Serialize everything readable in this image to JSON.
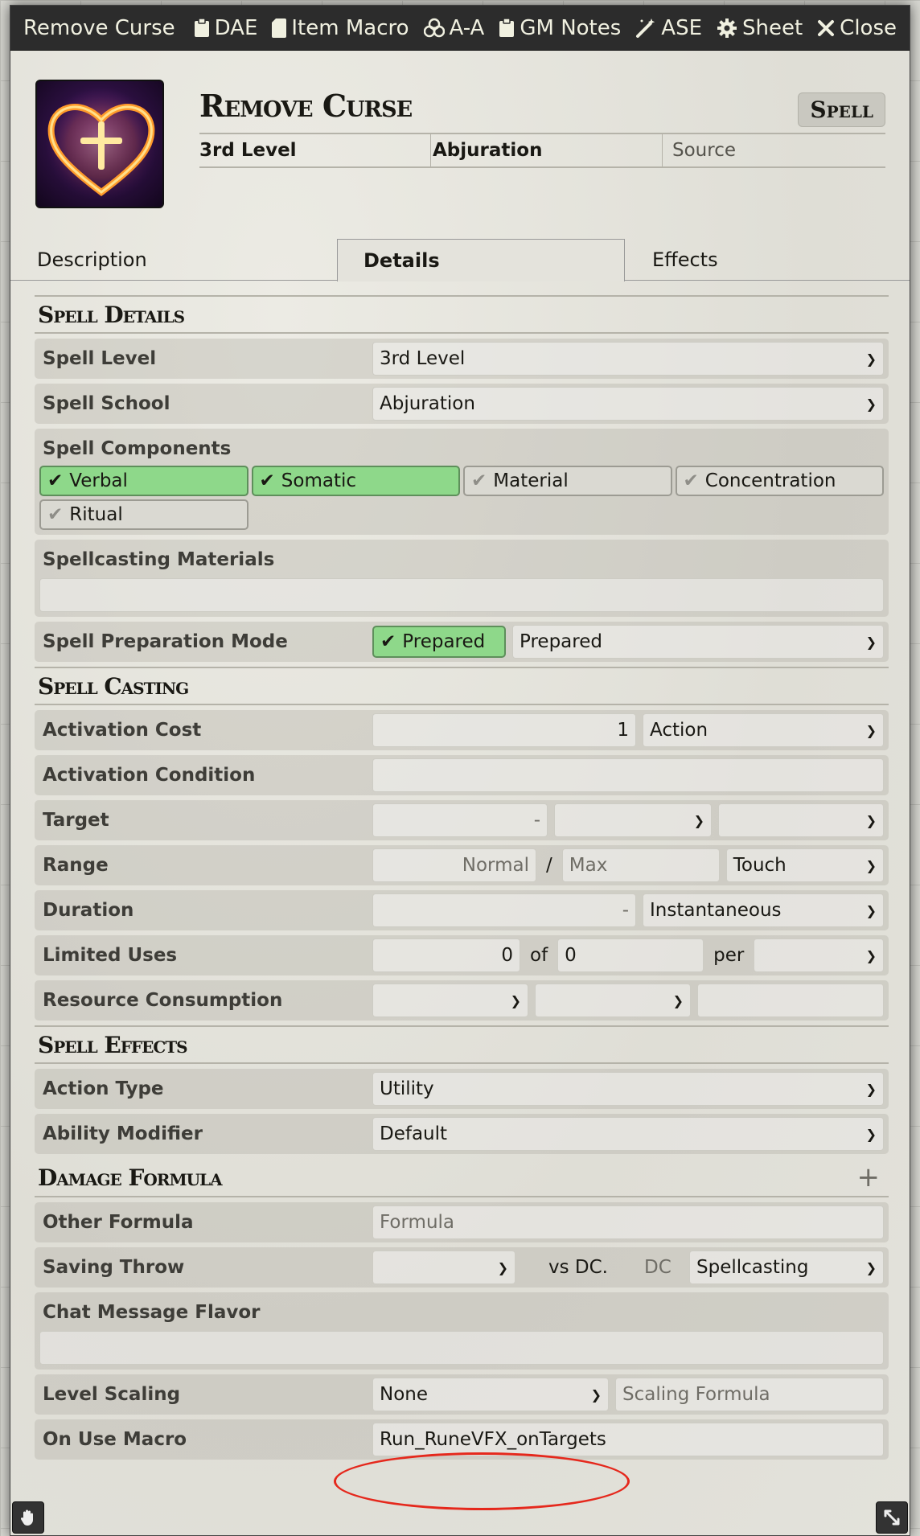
{
  "window": {
    "title": "Remove Curse",
    "header_buttons": [
      {
        "label": "DAE",
        "icon": "clipboard-icon"
      },
      {
        "label": "Item Macro",
        "icon": "sd-card-icon"
      },
      {
        "label": "A-A",
        "icon": "biohazard-icon"
      },
      {
        "label": "GM Notes",
        "icon": "clipboard-icon"
      },
      {
        "label": "ASE",
        "icon": "magic-wand-icon"
      },
      {
        "label": "Sheet",
        "icon": "gear-icon"
      },
      {
        "label": "Close",
        "icon": "close-icon"
      }
    ]
  },
  "item": {
    "name": "Remove Curse",
    "type": "Spell",
    "level": "3rd Level",
    "school": "Abjuration",
    "source_placeholder": "Source"
  },
  "tabs": [
    {
      "label": "Description",
      "active": false
    },
    {
      "label": "Details",
      "active": true
    },
    {
      "label": "Effects",
      "active": false
    }
  ],
  "spell_details": {
    "heading": "Spell Details",
    "spell_level": {
      "label": "Spell Level",
      "value": "3rd Level"
    },
    "spell_school": {
      "label": "Spell School",
      "value": "Abjuration"
    },
    "components": {
      "label": "Spell Components",
      "items": [
        {
          "label": "Verbal",
          "checked": true
        },
        {
          "label": "Somatic",
          "checked": true
        },
        {
          "label": "Material",
          "checked": false
        },
        {
          "label": "Concentration",
          "checked": false
        },
        {
          "label": "Ritual",
          "checked": false
        }
      ]
    },
    "materials": {
      "label": "Spellcasting Materials",
      "value": ""
    },
    "preparation": {
      "label": "Spell Preparation Mode",
      "toggle": "Prepared",
      "toggle_checked": true,
      "value": "Prepared"
    }
  },
  "spell_casting": {
    "heading": "Spell Casting",
    "activation_cost": {
      "label": "Activation Cost",
      "value": "1",
      "unit": "Action"
    },
    "activation_condition": {
      "label": "Activation Condition",
      "value": ""
    },
    "target": {
      "label": "Target",
      "value": "-",
      "unit": "",
      "type": ""
    },
    "range": {
      "label": "Range",
      "normal": "Normal",
      "sep": "/",
      "max": "Max",
      "unit": "Touch"
    },
    "duration": {
      "label": "Duration",
      "value": "-",
      "unit": "Instantaneous"
    },
    "limited_uses": {
      "label": "Limited Uses",
      "value": "0",
      "of": "of",
      "max": "0",
      "per": "per",
      "period": ""
    },
    "resource": {
      "label": "Resource Consumption",
      "type": "",
      "target": "",
      "amount": ""
    }
  },
  "spell_effects": {
    "heading": "Spell Effects",
    "action_type": {
      "label": "Action Type",
      "value": "Utility"
    },
    "ability_modifier": {
      "label": "Ability Modifier",
      "value": "Default"
    }
  },
  "damage": {
    "heading": "Damage Formula",
    "add": "+",
    "other_formula": {
      "label": "Other Formula",
      "placeholder": "Formula"
    },
    "saving_throw": {
      "label": "Saving Throw",
      "ability": "",
      "vs": "vs DC.",
      "dc": "DC",
      "scaling": "Spellcasting"
    },
    "chat_flavor": {
      "label": "Chat Message Flavor",
      "value": ""
    },
    "level_scaling": {
      "label": "Level Scaling",
      "value": "None",
      "formula_placeholder": "Scaling Formula"
    },
    "on_use_macro": {
      "label": "On Use Macro",
      "value": "Run_RuneVFX_onTargets"
    }
  },
  "colors": {
    "annotation_ring": "#e5281c",
    "checked": "#8ed88a"
  }
}
